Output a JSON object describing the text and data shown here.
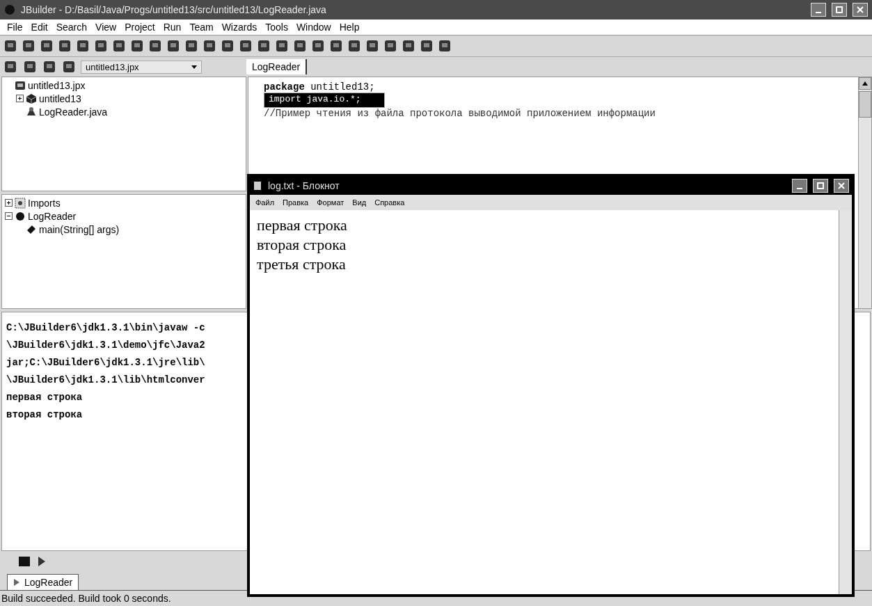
{
  "window": {
    "title": "JBuilder - D:/Basil/Java/Progs/untitled13/src/untitled13/LogReader.java"
  },
  "menu": [
    {
      "label": "File"
    },
    {
      "label": "Edit"
    },
    {
      "label": "Search"
    },
    {
      "label": "View"
    },
    {
      "label": "Project"
    },
    {
      "label": "Run"
    },
    {
      "label": "Team"
    },
    {
      "label": "Wizards"
    },
    {
      "label": "Tools"
    },
    {
      "label": "Window"
    },
    {
      "label": "Help"
    }
  ],
  "project_selector": {
    "value": "untitled13.jpx"
  },
  "project_tree": [
    {
      "label": "untitled13.jpx",
      "kind": "project",
      "children": [
        {
          "label": "untitled13",
          "kind": "package",
          "expanded": false
        },
        {
          "label": "LogReader.java",
          "kind": "class-file"
        }
      ]
    }
  ],
  "structure_tree": [
    {
      "label": "Imports",
      "kind": "imports",
      "expanded": false
    },
    {
      "label": "LogReader",
      "kind": "class",
      "expanded": true,
      "children": [
        {
          "label": "main(String[] args)",
          "kind": "method"
        }
      ]
    }
  ],
  "editor_tabs": [
    {
      "label": "LogReader",
      "selected": true
    }
  ],
  "code_lines": [
    {
      "text": "**package** untitled13;",
      "kind": "code",
      "selected": false
    },
    {
      "text": "import java.io.*;",
      "kind": "code",
      "selected": true
    },
    {
      "text": "//Пример чтения из файла протокола выводимой приложением информации",
      "kind": "comment",
      "selected": false
    }
  ],
  "console": {
    "lines": [
      "C:\\JBuilder6\\jdk1.3.1\\bin\\javaw -c",
      "\\JBuilder6\\jdk1.3.1\\demo\\jfc\\Java2",
      "jar;C:\\JBuilder6\\jdk1.3.1\\jre\\lib\\",
      "\\JBuilder6\\jdk1.3.1\\lib\\htmlconver",
      "первая строка",
      "вторая строка"
    ]
  },
  "message_tabs": [
    {
      "label": "LogReader",
      "selected": true
    }
  ],
  "status_bar": {
    "text": "Build succeeded.  Build took 0 seconds."
  },
  "notepad": {
    "title": "log.txt - Блокнот",
    "menu": [
      "Файл",
      "Правка",
      "Формат",
      "Вид",
      "Справка"
    ],
    "lines": [
      "первая строка",
      "вторая строка",
      "третья строка"
    ]
  }
}
